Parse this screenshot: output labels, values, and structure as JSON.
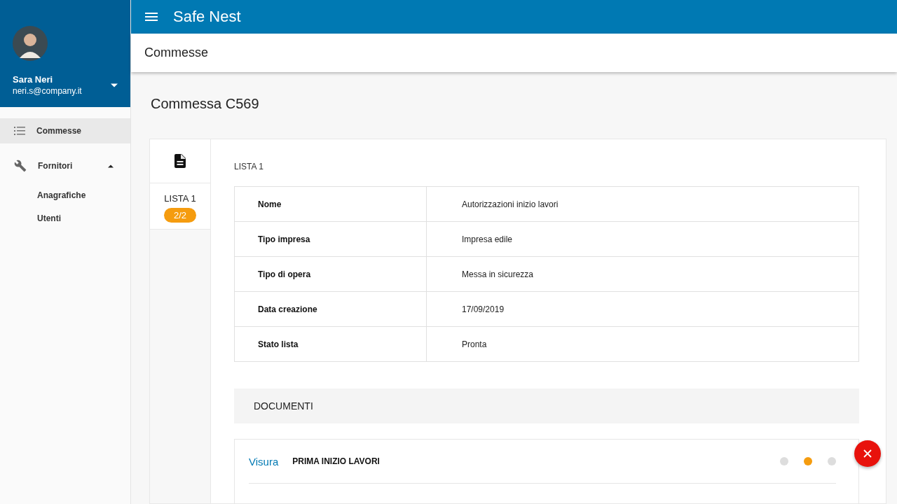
{
  "user": {
    "name": "Sara Neri",
    "email": "neri.s@company.it"
  },
  "nav": [
    {
      "label": "Commesse",
      "selected": true
    },
    {
      "label": "Fornitori",
      "selected": false,
      "expanded": true,
      "children": [
        {
          "label": "Anagrafiche",
          "selected": false
        },
        {
          "label": "Utenti",
          "selected": false
        }
      ]
    }
  ],
  "app_title": "Safe Nest",
  "section_title": "Commesse",
  "page_title": "Commessa C569",
  "tabs": [
    {
      "label": "LISTA 1",
      "badge": "2/2",
      "selected": true
    }
  ],
  "list_title": "LISTA 1",
  "details": [
    {
      "label": "Nome",
      "value": "Autorizzazioni inizio lavori"
    },
    {
      "label": "Tipo impresa",
      "value": "Impresa edile"
    },
    {
      "label": "Tipo di opera",
      "value": "Messa in sicurezza"
    },
    {
      "label": "Data creazione",
      "value": "17/09/2019"
    },
    {
      "label": "Stato lista",
      "value": "Pronta"
    }
  ],
  "documents_title": "DOCUMENTI",
  "documents": [
    {
      "type": "Visura",
      "name": "PRIMA INIZIO LAVORI",
      "steps": [
        {
          "color": "#dddddd"
        },
        {
          "color": "#f59c0f"
        },
        {
          "color": "#dddddd"
        }
      ]
    }
  ]
}
